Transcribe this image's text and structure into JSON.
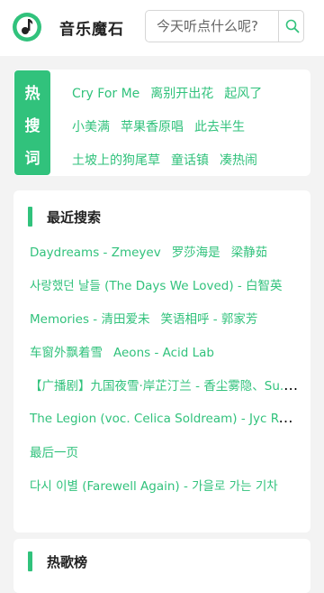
{
  "header": {
    "app_title": "音乐魔石",
    "search_placeholder": "今天听点什么呢?"
  },
  "hot_words": {
    "label_chars": [
      "热",
      "搜",
      "词"
    ],
    "rows": [
      [
        "Cry For Me",
        "离别开出花",
        "起风了"
      ],
      [
        "小美满",
        "苹果香原唱",
        "此去半生"
      ],
      [
        "土坡上的狗尾草",
        "童话镇",
        "凑热闹"
      ]
    ]
  },
  "recent": {
    "title": "最近搜索",
    "rows": [
      [
        "Daydreams - Zmeyev",
        "罗莎海是",
        "梁静茹"
      ],
      [
        "사랑했던 날들 (The Days We Loved) - 白智英"
      ],
      [
        "Memories - 清田爱未",
        "笑语相呼 - 郭家芳"
      ],
      [
        "车窗外飘着雪",
        "Aeons - Acid Lab"
      ],
      [
        "【广播剧】九国夜雪·岸芷汀兰 - 香尘雾隐、Su..."
      ],
      [
        "The Legion (voc. Celica Soldream) - Jyc Row"
      ],
      [
        "最后一页"
      ],
      [
        "다시 이별 (Farewell Again) - 가을로 가는 기차"
      ]
    ]
  },
  "charts": {
    "title": "热歌榜"
  },
  "colors": {
    "accent": "#31c27c",
    "background": "#f3f3f3"
  }
}
